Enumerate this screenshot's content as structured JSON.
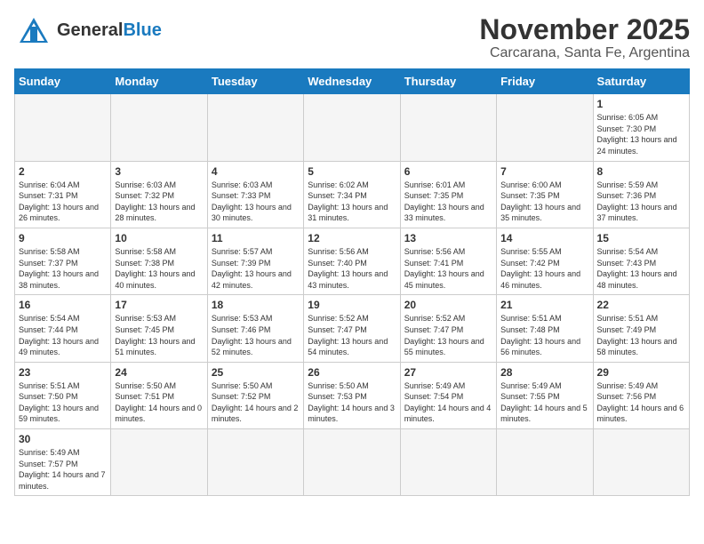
{
  "header": {
    "logo_general": "General",
    "logo_blue": "Blue",
    "month_title": "November 2025",
    "location": "Carcarana, Santa Fe, Argentina"
  },
  "weekdays": [
    "Sunday",
    "Monday",
    "Tuesday",
    "Wednesday",
    "Thursday",
    "Friday",
    "Saturday"
  ],
  "days": {
    "1": {
      "sunrise": "6:05 AM",
      "sunset": "7:30 PM",
      "daylight": "13 hours and 24 minutes."
    },
    "2": {
      "sunrise": "6:04 AM",
      "sunset": "7:31 PM",
      "daylight": "13 hours and 26 minutes."
    },
    "3": {
      "sunrise": "6:03 AM",
      "sunset": "7:32 PM",
      "daylight": "13 hours and 28 minutes."
    },
    "4": {
      "sunrise": "6:03 AM",
      "sunset": "7:33 PM",
      "daylight": "13 hours and 30 minutes."
    },
    "5": {
      "sunrise": "6:02 AM",
      "sunset": "7:34 PM",
      "daylight": "13 hours and 31 minutes."
    },
    "6": {
      "sunrise": "6:01 AM",
      "sunset": "7:35 PM",
      "daylight": "13 hours and 33 minutes."
    },
    "7": {
      "sunrise": "6:00 AM",
      "sunset": "7:35 PM",
      "daylight": "13 hours and 35 minutes."
    },
    "8": {
      "sunrise": "5:59 AM",
      "sunset": "7:36 PM",
      "daylight": "13 hours and 37 minutes."
    },
    "9": {
      "sunrise": "5:58 AM",
      "sunset": "7:37 PM",
      "daylight": "13 hours and 38 minutes."
    },
    "10": {
      "sunrise": "5:58 AM",
      "sunset": "7:38 PM",
      "daylight": "13 hours and 40 minutes."
    },
    "11": {
      "sunrise": "5:57 AM",
      "sunset": "7:39 PM",
      "daylight": "13 hours and 42 minutes."
    },
    "12": {
      "sunrise": "5:56 AM",
      "sunset": "7:40 PM",
      "daylight": "13 hours and 43 minutes."
    },
    "13": {
      "sunrise": "5:56 AM",
      "sunset": "7:41 PM",
      "daylight": "13 hours and 45 minutes."
    },
    "14": {
      "sunrise": "5:55 AM",
      "sunset": "7:42 PM",
      "daylight": "13 hours and 46 minutes."
    },
    "15": {
      "sunrise": "5:54 AM",
      "sunset": "7:43 PM",
      "daylight": "13 hours and 48 minutes."
    },
    "16": {
      "sunrise": "5:54 AM",
      "sunset": "7:44 PM",
      "daylight": "13 hours and 49 minutes."
    },
    "17": {
      "sunrise": "5:53 AM",
      "sunset": "7:45 PM",
      "daylight": "13 hours and 51 minutes."
    },
    "18": {
      "sunrise": "5:53 AM",
      "sunset": "7:46 PM",
      "daylight": "13 hours and 52 minutes."
    },
    "19": {
      "sunrise": "5:52 AM",
      "sunset": "7:47 PM",
      "daylight": "13 hours and 54 minutes."
    },
    "20": {
      "sunrise": "5:52 AM",
      "sunset": "7:47 PM",
      "daylight": "13 hours and 55 minutes."
    },
    "21": {
      "sunrise": "5:51 AM",
      "sunset": "7:48 PM",
      "daylight": "13 hours and 56 minutes."
    },
    "22": {
      "sunrise": "5:51 AM",
      "sunset": "7:49 PM",
      "daylight": "13 hours and 58 minutes."
    },
    "23": {
      "sunrise": "5:51 AM",
      "sunset": "7:50 PM",
      "daylight": "13 hours and 59 minutes."
    },
    "24": {
      "sunrise": "5:50 AM",
      "sunset": "7:51 PM",
      "daylight": "14 hours and 0 minutes."
    },
    "25": {
      "sunrise": "5:50 AM",
      "sunset": "7:52 PM",
      "daylight": "14 hours and 2 minutes."
    },
    "26": {
      "sunrise": "5:50 AM",
      "sunset": "7:53 PM",
      "daylight": "14 hours and 3 minutes."
    },
    "27": {
      "sunrise": "5:49 AM",
      "sunset": "7:54 PM",
      "daylight": "14 hours and 4 minutes."
    },
    "28": {
      "sunrise": "5:49 AM",
      "sunset": "7:55 PM",
      "daylight": "14 hours and 5 minutes."
    },
    "29": {
      "sunrise": "5:49 AM",
      "sunset": "7:56 PM",
      "daylight": "14 hours and 6 minutes."
    },
    "30": {
      "sunrise": "5:49 AM",
      "sunset": "7:57 PM",
      "daylight": "14 hours and 7 minutes."
    }
  },
  "labels": {
    "sunrise": "Sunrise:",
    "sunset": "Sunset:",
    "daylight": "Daylight:"
  }
}
